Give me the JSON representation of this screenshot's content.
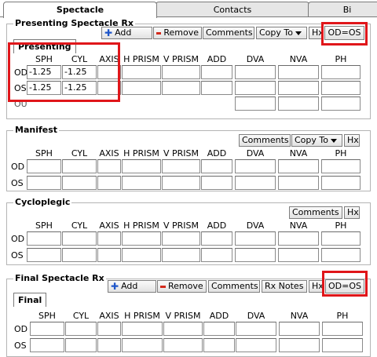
{
  "tabs": [
    "Spectacle",
    "Contacts",
    "Bi"
  ],
  "columns": [
    "SPH",
    "CYL",
    "AXIS",
    "H PRISM",
    "V PRISM",
    "ADD",
    "DVA",
    "NVA",
    "PH"
  ],
  "row_labels": {
    "od": "OD",
    "os": "OS",
    "ou": "OU"
  },
  "presenting": {
    "title": "Presenting Spectacle Rx",
    "subtab": "Presenting",
    "buttons": {
      "add": "Add",
      "remove": "Remove",
      "comments": "Comments",
      "copy_to": "Copy To",
      "hx": "Hx",
      "od_os": "OD=OS"
    },
    "od": {
      "sph": "-1.25",
      "cyl": "-1.25"
    },
    "os": {
      "sph": "-1.25",
      "cyl": "-1.25"
    }
  },
  "manifest": {
    "title": "Manifest",
    "buttons": {
      "comments": "Comments",
      "copy_to": "Copy To",
      "hx": "Hx"
    }
  },
  "cycloplegic": {
    "title": "Cycloplegic",
    "buttons": {
      "comments": "Comments",
      "hx": "Hx"
    }
  },
  "final": {
    "title": "Final Spectacle Rx",
    "subtab": "Final",
    "buttons": {
      "add": "Add",
      "remove": "Remove",
      "comments": "Comments",
      "rx_notes": "Rx Notes",
      "hx": "Hx",
      "od_os": "OD=OS"
    }
  },
  "colors": {
    "highlight": "#e0161a",
    "add_icon": "#1f56c9",
    "remove_icon": "#d22a1c"
  }
}
